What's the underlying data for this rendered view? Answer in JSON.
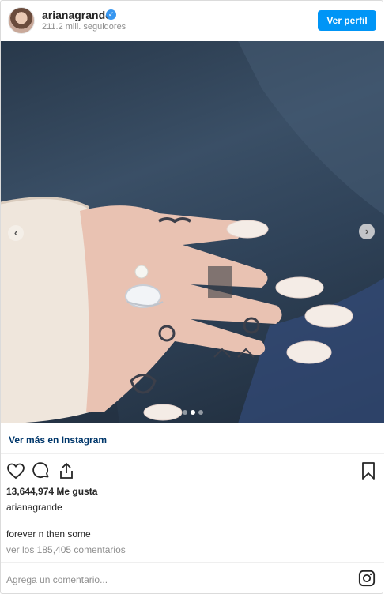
{
  "header": {
    "username": "arianagrande",
    "followers": "211.2 mill. seguidores",
    "view_profile_label": "Ver perfil"
  },
  "post": {
    "more_link": "Ver más en Instagram",
    "likes": "13,644,974 Me gusta",
    "owner": "arianagrande",
    "caption": "forever n then some",
    "comments_link": "ver los 185,405 comentarios",
    "comment_placeholder": "Agrega un comentario..."
  },
  "carousel": {
    "slide_count": 3,
    "active_index": 1
  },
  "icons": {
    "verified": "verified-badge-icon",
    "like": "heart-icon",
    "comment": "comment-icon",
    "share": "share-icon",
    "save": "bookmark-icon",
    "instagram": "instagram-icon",
    "prev": "chevron-left-icon",
    "next": "chevron-right-icon"
  },
  "colors": {
    "primary_button": "#0095f6",
    "link": "#00376b",
    "muted": "#8e8e8e",
    "verified": "#3897f0"
  }
}
